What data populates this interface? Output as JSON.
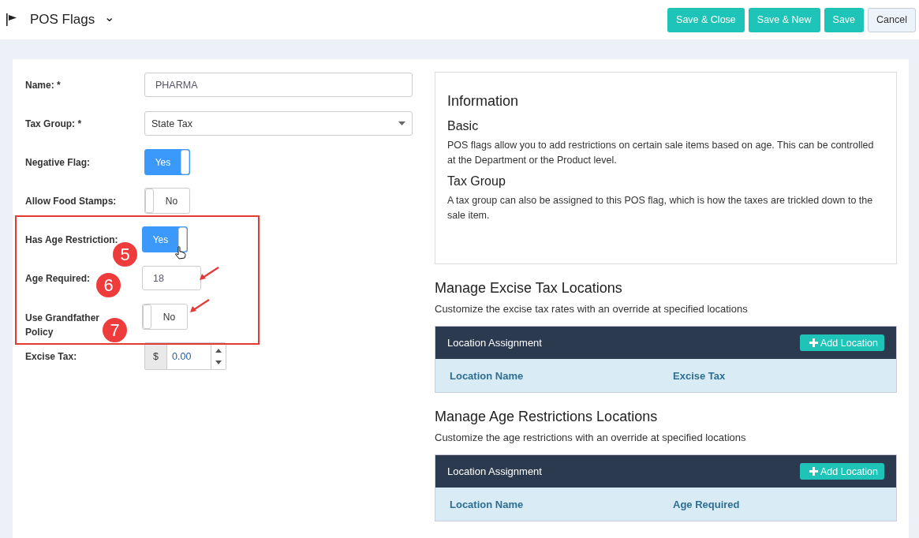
{
  "header": {
    "title": "POS Flags",
    "dropdown_glyph": "⌄",
    "buttons": [
      {
        "label": "Save & Close",
        "kind": "primary"
      },
      {
        "label": "Save & New",
        "kind": "primary"
      },
      {
        "label": "Save",
        "kind": "primary"
      },
      {
        "label": "Cancel",
        "kind": "secondary"
      }
    ]
  },
  "form": {
    "fields": [
      {
        "label": "Name: *",
        "kind": "text",
        "value": "PHARMA"
      },
      {
        "label": "Tax Group: *",
        "kind": "select",
        "value": "State Tax"
      },
      {
        "label": "Negative Flag:",
        "kind": "toggle",
        "on": true,
        "value": "Yes"
      },
      {
        "label": "Allow Food Stamps:",
        "kind": "toggle",
        "on": false,
        "value": "No"
      },
      {
        "label": "Has Age Restriction:",
        "kind": "toggle",
        "on": true,
        "value": "Yes"
      },
      {
        "label": "Age Required:",
        "kind": "text",
        "value": "18"
      },
      {
        "label": "Use Grandfather Policy",
        "kind": "toggle",
        "on": false,
        "value": "No"
      },
      {
        "label": "Excise Tax:",
        "kind": "currency",
        "prefix": "$",
        "value": "0.00"
      }
    ]
  },
  "annotations": {
    "markers": [
      "5",
      "6",
      "7"
    ]
  },
  "information": {
    "title": "Information",
    "sections": [
      {
        "heading": "Basic",
        "text": "POS flags allow you to add restrictions on certain sale items based on age. This can be controlled at the Department or the Product level."
      },
      {
        "heading": "Tax Group",
        "text": "A tax group can also be assigned to this POS flag, which is how the taxes are trickled down to the sale item."
      }
    ]
  },
  "location_sections": [
    {
      "title": "Manage Excise Tax Locations",
      "description": "Customize the excise tax rates with an override at specified locations",
      "table_title": "Location Assignment",
      "add_button": "Add Location",
      "columns": [
        "Location Name",
        "Excise Tax"
      ]
    },
    {
      "title": "Manage Age Restrictions Locations",
      "description": "Customize the age restrictions with an override at specified locations",
      "table_title": "Location Assignment",
      "add_button": "Add Location",
      "columns": [
        "Location Name",
        "Age Required"
      ]
    }
  ]
}
